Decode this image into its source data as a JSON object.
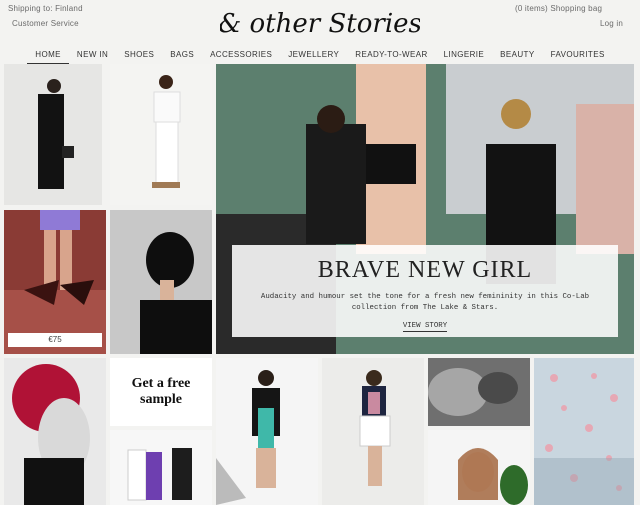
{
  "header": {
    "shipping": "Shipping to: Finland",
    "customer_service": "Customer Service",
    "logo": "& other Stories",
    "bag": "(0 items) Shopping bag",
    "login": "Log in"
  },
  "nav": [
    "HOME",
    "NEW IN",
    "SHOES",
    "BAGS",
    "ACCESSORIES",
    "JEWELLERY",
    "READY-TO-WEAR",
    "LINGERIE",
    "BEAUTY",
    "FAVOURITES"
  ],
  "hero": {
    "title": "BRAVE NEW GIRL",
    "subtitle": "Audacity and humour set the tone for a fresh new femininity in this Co-Lab collection from The Lake & Stars.",
    "link": "VIEW STORY"
  },
  "price_tag": "€75",
  "promo": "Get a free sample"
}
